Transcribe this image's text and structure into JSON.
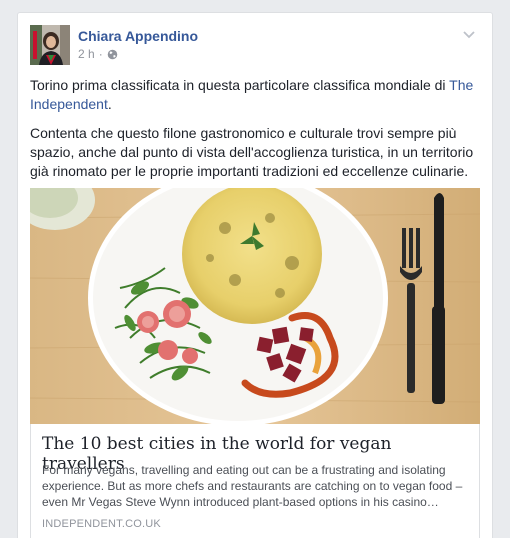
{
  "post": {
    "author": "Chiara Appendino",
    "time": "2 h",
    "separator": "·",
    "paragraph1_text": "Torino prima classificata in questa particolare classifica mondiale di ",
    "paragraph1_link": "The Independent",
    "paragraph1_end": ".",
    "paragraph2": "Contenta che questo filone gastronomico e culturale trovi sempre più spazio, anche dal punto di vista dell'accoglienza turistica, in un territorio già rinomato per le proprie importanti tradizioni ed eccellenze culinarie."
  },
  "link_preview": {
    "title": "The 10 best cities in the world for vegan travellers",
    "description": "For many vegans, travelling and eating out can be a frustrating and isolating experience. But as more chefs and restaurants are catching on to vegan food – even Mr Vegas Steve Wynn introduced plant-based options in his casino…",
    "domain": "INDEPENDENT.CO.UK"
  },
  "icons": {
    "privacy": "globe-icon",
    "menu": "chevron-down-icon"
  },
  "colors": {
    "link": "#365899",
    "background": "#e9ebee",
    "meta": "#90949c"
  }
}
